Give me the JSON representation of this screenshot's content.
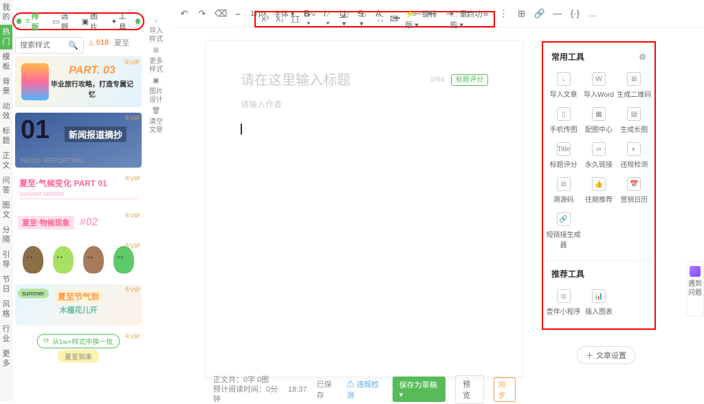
{
  "left_nav": {
    "items": [
      "我的",
      "热门",
      "模板",
      "背景",
      "动效",
      "标题",
      "正文",
      "问答",
      "图文",
      "分隔",
      "引导",
      "节日",
      "风格",
      "行业",
      "更多"
    ],
    "active_index": 1
  },
  "top_tabs": {
    "items": [
      "排版",
      "选题",
      "图片",
      "工具"
    ],
    "active_index": 0
  },
  "search": {
    "placeholder": "搜索样式"
  },
  "trending": {
    "count": "618",
    "label": "夏至"
  },
  "secondary_nav": {
    "items": [
      "导入样式",
      "更多样式",
      "图片设计",
      "清空文章"
    ]
  },
  "templates": {
    "card1": {
      "title": "PART. 03",
      "subtitle": "毕业旅行攻略，打造专属记忆"
    },
    "card2": {
      "num": "01",
      "title": "新闻报道摘抄",
      "subtitle": "NEWS REPORTING"
    },
    "card3": {
      "title": "夏至·气候变化  PART 01",
      "subtitle": "summer solstice"
    },
    "card4": {
      "title": "夏至·物候现象",
      "num": "#02"
    },
    "card6": {
      "badge": "summer",
      "title": "夏至节气到",
      "subtitle": "木槿花儿开"
    },
    "card7": {
      "pill": "从1w+样式中换一批",
      "badge": "夏至到来"
    }
  },
  "vip": "VIP",
  "toolbar": {
    "undo": "↶",
    "redo": "↷",
    "clear_format": "⌫",
    "format_brush": "⌢",
    "font_size": "17px",
    "font_dropdown": "字体 ▾",
    "bold": "B",
    "italic": "I",
    "underline": "U",
    "strike": "S",
    "color": "A",
    "more": "…"
  },
  "second_toolbar": {
    "items": [
      "X²",
      "X₂",
      "T̲T̲",
      "⩒⩒ ▾",
      "⟋ ▾",
      "☑ ▾",
      "☺ ▾",
      "⛶",
      "🖾",
      "⚡一键排版 ▾",
      "⬚ 重点功能 ▾"
    ]
  },
  "editor": {
    "title_placeholder": "请在这里输入标题",
    "title_counter": "0/64",
    "title_score_btn": "标题评分",
    "author_placeholder": "请输入作者"
  },
  "right_panel": {
    "section1_title": "常用工具",
    "section2_title": "推荐工具",
    "common_tools": [
      {
        "icon": "↓",
        "label": "导入文章"
      },
      {
        "icon": "W",
        "label": "导入Word"
      },
      {
        "icon": "⊞",
        "label": "生成二维码"
      },
      {
        "icon": "▯",
        "label": "手机传图"
      },
      {
        "icon": "▦",
        "label": "配图中心"
      },
      {
        "icon": "▤",
        "label": "生成长图"
      },
      {
        "icon": "Title",
        "label": "标题评分"
      },
      {
        "icon": "∞",
        "label": "永久链接"
      },
      {
        "icon": "◐",
        "label": "违规检测"
      },
      {
        "icon": "⧉",
        "label": "溯源码"
      },
      {
        "icon": "👍",
        "label": "往期推荐"
      },
      {
        "icon": "📅",
        "label": "营销日历"
      },
      {
        "icon": "🔗",
        "label": "短链接生成器"
      }
    ],
    "recommend_tools": [
      {
        "icon": "◎",
        "label": "壹伴小程序"
      },
      {
        "icon": "📊",
        "label": "插入图表"
      }
    ]
  },
  "bottom_bar": {
    "text_count_label": "正文共：",
    "text_count": "0字 0图",
    "read_time_label": "预计阅读时间：",
    "read_time": "0分钟",
    "saved_time": "18:37",
    "saved_label": "已保存",
    "violation_btn": "违规检测",
    "save_draft": "保存为草稿 ▾",
    "preview": "预览",
    "sync": "同步"
  },
  "article_settings": {
    "label": "文章设置"
  },
  "far_right": {
    "label": "遇到问题"
  }
}
